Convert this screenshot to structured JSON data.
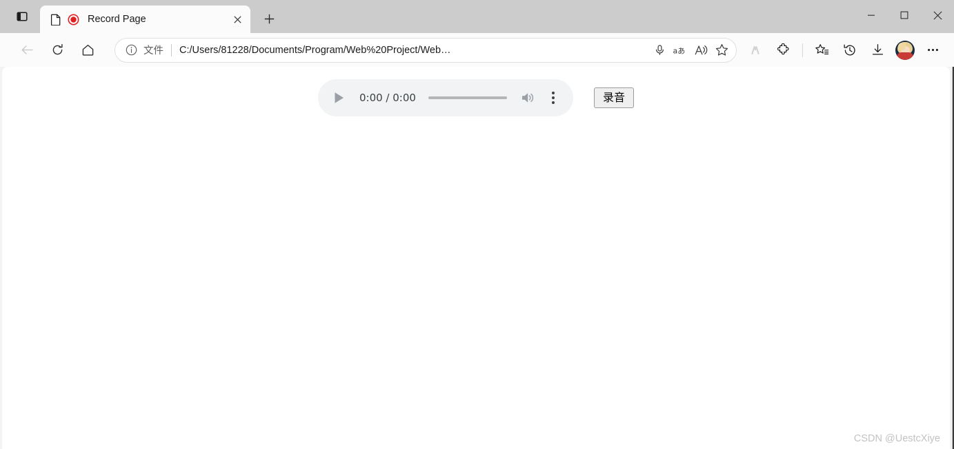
{
  "window": {
    "controls": {
      "minimize": "minimize-icon",
      "maximize": "maximize-icon",
      "close": "close-icon"
    }
  },
  "tabstrip": {
    "tab_actions_icon": "vertical-tabs-icon",
    "new_tab_icon": "plus-icon",
    "tabs": [
      {
        "title": "Record Page",
        "favicon": "document-icon",
        "recording_indicator": "record-dot-icon",
        "close_icon": "close-icon",
        "active": true
      }
    ]
  },
  "toolbar": {
    "back_icon": "back-arrow-icon",
    "back_disabled": true,
    "refresh_icon": "refresh-icon",
    "home_icon": "home-icon",
    "address": {
      "info_icon": "info-circle-icon",
      "scheme_label": "文件",
      "url": "C:/Users/81228/Documents/Program/Web%20Project/Web…",
      "mic_icon": "microphone-icon",
      "translate_icon": "translate-aa-icon",
      "read_aloud_icon": "read-aloud-icon",
      "favorite_icon": "star-icon"
    },
    "right_icons": [
      {
        "name": "split-screen-icon",
        "dimmed": true
      },
      {
        "name": "extensions-puzzle-icon",
        "dimmed": false
      },
      {
        "name": "collections-icon",
        "dimmed": false
      },
      {
        "name": "history-icon",
        "dimmed": false
      },
      {
        "name": "downloads-icon",
        "dimmed": false
      }
    ],
    "avatar": "profile-avatar",
    "settings_icon": "more-ellipsis-icon"
  },
  "content": {
    "audio_player": {
      "play_icon": "play-triangle-icon",
      "time_display": "0:00 / 0:00",
      "current_time": "0:00",
      "duration": "0:00",
      "progress_percent": 0,
      "volume_icon": "volume-speaker-icon",
      "menu_icon": "vertical-ellipsis-icon"
    },
    "record_button_label": "录音",
    "watermark": "CSDN @UestcXiye"
  },
  "colors": {
    "tabstrip_bg": "#cccccc",
    "toolbar_bg": "#fbfbfb",
    "page_bg": "#ffffff",
    "player_bg": "#f1f3f4",
    "record_indicator": "#e02020",
    "watermark": "#c2c2c2"
  }
}
